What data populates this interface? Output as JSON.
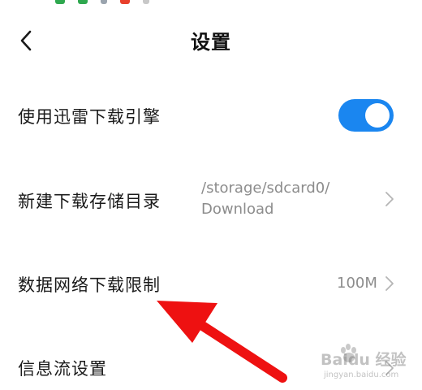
{
  "header": {
    "title": "设置",
    "back_icon": "chevron-left-icon"
  },
  "settings": {
    "thunder_engine": {
      "label": "使用迅雷下载引擎",
      "enabled": true,
      "toggle_color": "#1a86f0"
    },
    "storage_dir": {
      "label": "新建下载存储目录",
      "value_line1": "/storage/sdcard0/",
      "value_line2": "Download"
    },
    "data_limit": {
      "label": "数据网络下载限制",
      "value": "100M"
    },
    "feed_settings": {
      "label": "信息流设置"
    }
  },
  "annotation": {
    "arrow_color": "#ee1111"
  },
  "watermark": {
    "brand": "Baidu 经验",
    "url": "jingyan.baidu.com"
  },
  "status_bar_colors": [
    "#2fa84f",
    "#2fa84f",
    "#9aa4ae",
    "#e8402c"
  ]
}
